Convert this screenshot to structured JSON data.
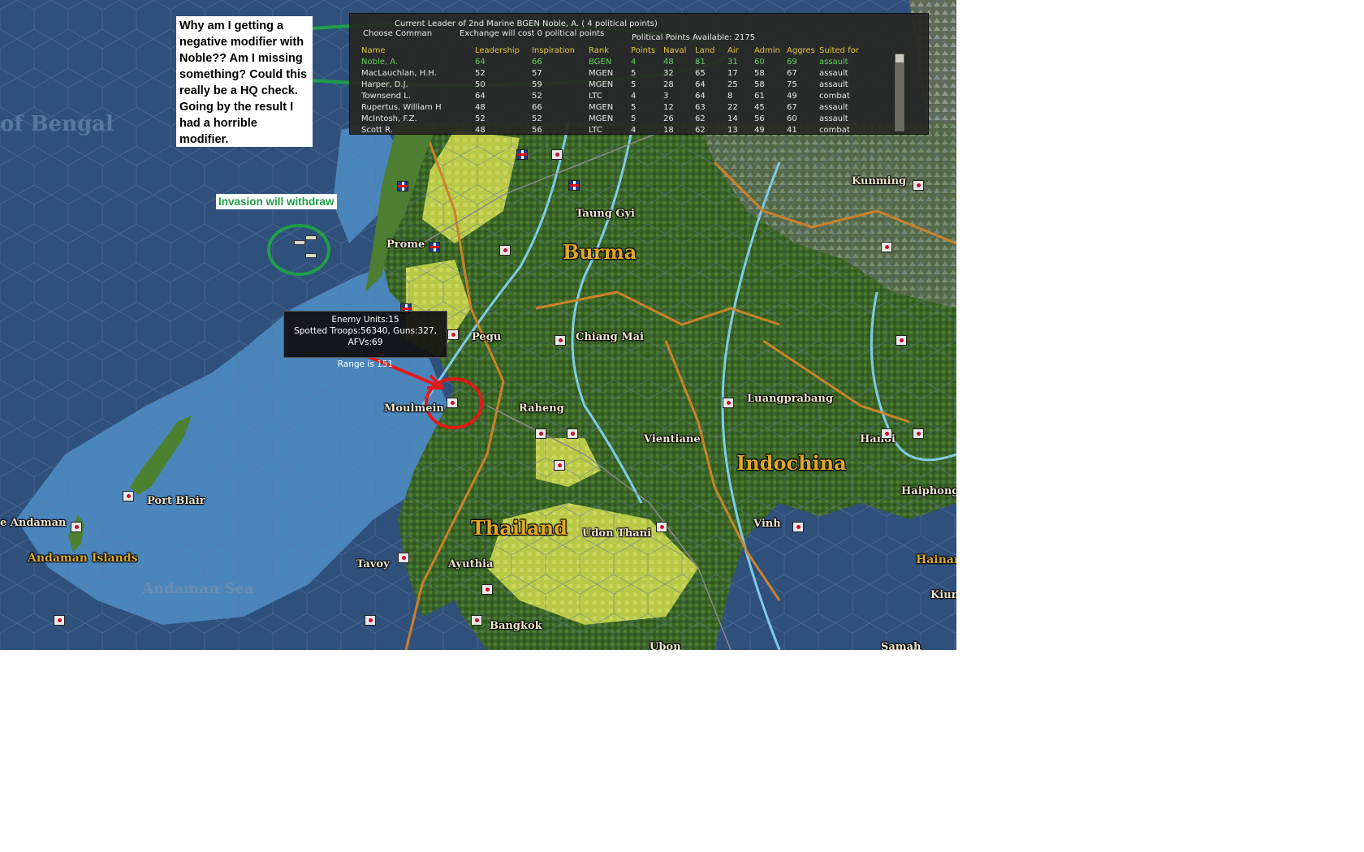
{
  "map": {
    "regions": {
      "burma": "Burma",
      "thailand": "Thailand",
      "indochina": "Indochina",
      "bay_of_bengal": "of Bengal",
      "andaman_sea": "Andaman Sea",
      "andaman_islands": "Andaman Islands"
    },
    "places": {
      "prome": "Prome",
      "taung_gyi": "Taung Gyi",
      "pegu": "Pegu",
      "chiang_mai": "Chiang Mai",
      "moulmein": "Moulmein",
      "raheng": "Raheng",
      "luangprabang": "Luangprabang",
      "vientiane": "Vientiane",
      "hanoi": "Hanoi",
      "haiphong": "Haiphong",
      "kunming": "Kunming",
      "port_blair": "Port Blair",
      "andaman": "e Andaman",
      "tavoy": "Tavoy",
      "ayuthia": "Ayuthia",
      "bangkok": "Bangkok",
      "udon_thani": "Udon Thani",
      "vinh": "Vinh",
      "hainan": "Hainan",
      "kiung": "Kiung",
      "samah": "Samah",
      "ubon": "Ubon"
    },
    "colors": {
      "sea": "#30507c",
      "shallow": "#4d88bd",
      "land": "#3f6b2a",
      "farmland": "#b7c744",
      "river": "#7ecbe6",
      "border": "#c9822a",
      "annotation_green": "#1f9e48",
      "annotation_red": "#e01919"
    }
  },
  "annotations": {
    "question": "Why am I getting a negative modifier with Noble?? Am I missing something? Could this really be a HQ check. Going by the result I had a horrible modifier.",
    "invasion": "Invasion will withdraw"
  },
  "leader_panel": {
    "current_leader": "Current Leader of 2nd Marine BGEN Noble, A. ( 4 political points)",
    "choose_commander": "Choose Comman",
    "exchange": "Exchange will cost 0 political points",
    "political_points": "Political Points Available:  2175",
    "columns": [
      "Name",
      "Leadership",
      "Inspiration",
      "Rank",
      "Points",
      "Naval",
      "Land",
      "Air",
      "Admin",
      "Aggres",
      "Suited for"
    ],
    "rows": [
      [
        "Noble, A.",
        "64",
        "66",
        "BGEN",
        "4",
        "48",
        "81",
        "31",
        "60",
        "69",
        "assault"
      ],
      [
        "MacLauchlan, H.H.",
        "52",
        "57",
        "MGEN",
        "5",
        "32",
        "65",
        "17",
        "58",
        "67",
        "assault"
      ],
      [
        "Harper, D.J.",
        "50",
        "59",
        "MGEN",
        "5",
        "28",
        "64",
        "25",
        "58",
        "75",
        "assault"
      ],
      [
        "Townsend L.",
        "64",
        "52",
        "LTC",
        "4",
        "3",
        "64",
        "8",
        "61",
        "49",
        "combat"
      ],
      [
        "Rupertus, William H",
        "48",
        "66",
        "MGEN",
        "5",
        "12",
        "63",
        "22",
        "45",
        "67",
        "assault"
      ],
      [
        "McIntosh, F.Z.",
        "52",
        "52",
        "MGEN",
        "5",
        "26",
        "62",
        "14",
        "56",
        "60",
        "assault"
      ],
      [
        "Scott R.",
        "48",
        "56",
        "LTC",
        "4",
        "18",
        "62",
        "13",
        "49",
        "41",
        "combat"
      ]
    ]
  },
  "tooltip": {
    "units": "Enemy Units:15",
    "spotted": "Spotted Troops:56340, Guns:327, AFVs:69",
    "range": "Range is 151"
  }
}
